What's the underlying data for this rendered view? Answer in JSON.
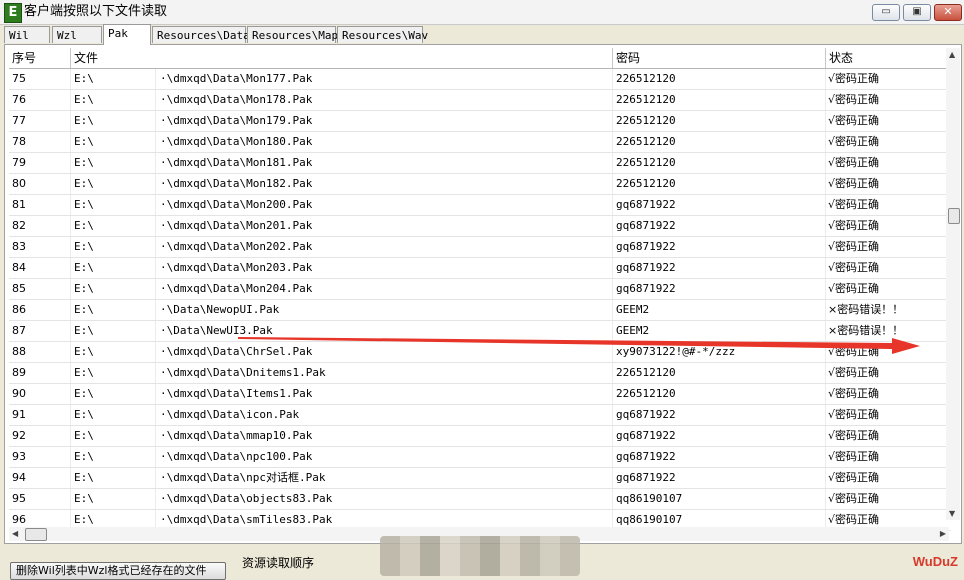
{
  "window": {
    "app_icon_letter": "E",
    "title": "客户端按照以下文件读取",
    "min_label": "▭",
    "max_label": "▣",
    "close_label": "✕"
  },
  "tabs": [
    "Wil",
    "Wzl",
    "Pak",
    "Resources\\Data",
    "Resources\\Map",
    "Resources\\Wav"
  ],
  "active_tab": "Pak",
  "columns": {
    "index": "序号",
    "file": "文件",
    "password": "密码",
    "status": "状态"
  },
  "rows": [
    {
      "idx": "75",
      "drive": "E:\\",
      "path": "·\\dmxqd\\Data\\Mon177.Pak",
      "pwd": "226512120",
      "status": "√密码正确"
    },
    {
      "idx": "76",
      "drive": "E:\\",
      "path": "·\\dmxqd\\Data\\Mon178.Pak",
      "pwd": "226512120",
      "status": "√密码正确"
    },
    {
      "idx": "77",
      "drive": "E:\\",
      "path": "·\\dmxqd\\Data\\Mon179.Pak",
      "pwd": "226512120",
      "status": "√密码正确"
    },
    {
      "idx": "78",
      "drive": "E:\\",
      "path": "·\\dmxqd\\Data\\Mon180.Pak",
      "pwd": "226512120",
      "status": "√密码正确"
    },
    {
      "idx": "79",
      "drive": "E:\\",
      "path": "·\\dmxqd\\Data\\Mon181.Pak",
      "pwd": "226512120",
      "status": "√密码正确"
    },
    {
      "idx": "80",
      "drive": "E:\\",
      "path": "·\\dmxqd\\Data\\Mon182.Pak",
      "pwd": "226512120",
      "status": "√密码正确"
    },
    {
      "idx": "81",
      "drive": "E:\\",
      "path": "·\\dmxqd\\Data\\Mon200.Pak",
      "pwd": "gq6871922",
      "status": "√密码正确"
    },
    {
      "idx": "82",
      "drive": "E:\\",
      "path": "·\\dmxqd\\Data\\Mon201.Pak",
      "pwd": "gq6871922",
      "status": "√密码正确"
    },
    {
      "idx": "83",
      "drive": "E:\\",
      "path": "·\\dmxqd\\Data\\Mon202.Pak",
      "pwd": "gq6871922",
      "status": "√密码正确"
    },
    {
      "idx": "84",
      "drive": "E:\\",
      "path": "·\\dmxqd\\Data\\Mon203.Pak",
      "pwd": "gq6871922",
      "status": "√密码正确"
    },
    {
      "idx": "85",
      "drive": "E:\\",
      "path": "·\\dmxqd\\Data\\Mon204.Pak",
      "pwd": "gq6871922",
      "status": "√密码正确"
    },
    {
      "idx": "86",
      "drive": "E:\\",
      "path": "·\\Data\\NewopUI.Pak",
      "pwd": "GEEM2",
      "status": "×密码错误！！"
    },
    {
      "idx": "87",
      "drive": "E:\\",
      "path": "·\\Data\\NewUI3.Pak",
      "pwd": "GEEM2",
      "status": "×密码错误！！"
    },
    {
      "idx": "88",
      "drive": "E:\\",
      "path": "·\\dmxqd\\Data\\ChrSel.Pak",
      "pwd": "xy9073122!@#-*/zzz",
      "status": "√密码正确"
    },
    {
      "idx": "89",
      "drive": "E:\\",
      "path": "·\\dmxqd\\Data\\Dnitems1.Pak",
      "pwd": "226512120",
      "status": "√密码正确"
    },
    {
      "idx": "90",
      "drive": "E:\\",
      "path": "·\\dmxqd\\Data\\Items1.Pak",
      "pwd": "226512120",
      "status": "√密码正确"
    },
    {
      "idx": "91",
      "drive": "E:\\",
      "path": "·\\dmxqd\\Data\\icon.Pak",
      "pwd": "gq6871922",
      "status": "√密码正确"
    },
    {
      "idx": "92",
      "drive": "E:\\",
      "path": "·\\dmxqd\\Data\\mmap10.Pak",
      "pwd": "gq6871922",
      "status": "√密码正确"
    },
    {
      "idx": "93",
      "drive": "E:\\",
      "path": "·\\dmxqd\\Data\\npc100.Pak",
      "pwd": "gq6871922",
      "status": "√密码正确"
    },
    {
      "idx": "94",
      "drive": "E:\\",
      "path": "·\\dmxqd\\Data\\npc对话框.Pak",
      "pwd": "gq6871922",
      "status": "√密码正确"
    },
    {
      "idx": "95",
      "drive": "E:\\",
      "path": "·\\dmxqd\\Data\\objects83.Pak",
      "pwd": "qq86190107",
      "status": "√密码正确"
    },
    {
      "idx": "96",
      "drive": "E:\\",
      "path": "·\\dmxqd\\Data\\smTiles83.Pak",
      "pwd": "qq86190107",
      "status": "√密码正确"
    }
  ],
  "bottom": {
    "delete_button": "删除Wil列表中Wzl格式已经存在的文件",
    "read_order_label": "资源读取顺序",
    "watermark": "WuDuZ"
  },
  "colors": {
    "arrow": "#e8352a",
    "error_text": "#000000"
  }
}
